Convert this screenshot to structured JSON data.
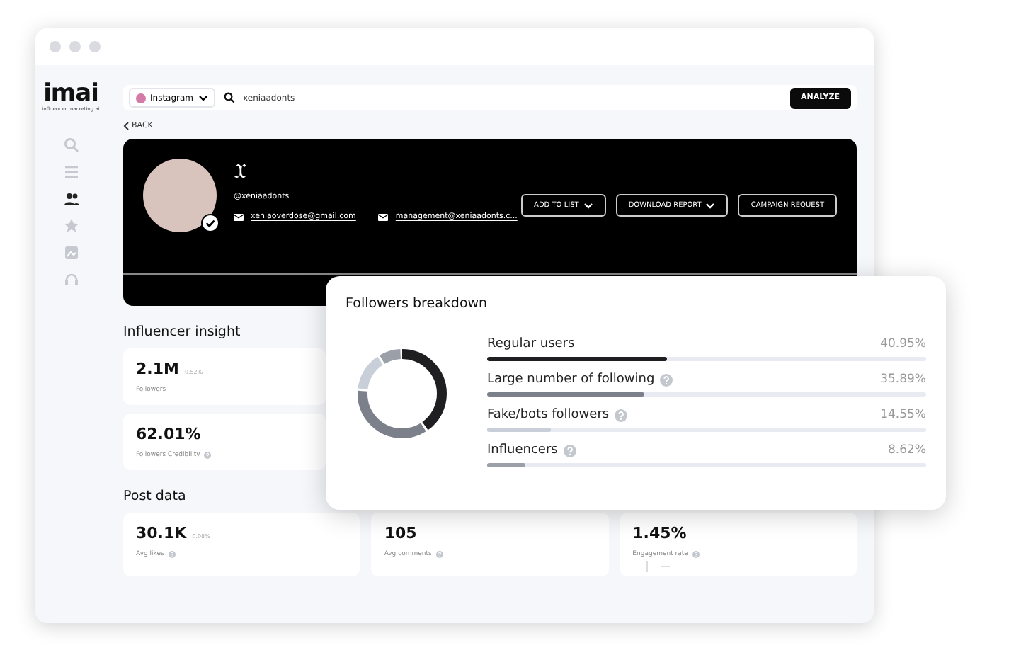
{
  "logo": {
    "name": "imai",
    "tagline": "influencer marketing ai"
  },
  "search": {
    "platform": "Instagram",
    "value": "xeniaadonts",
    "button": "ANALYZE"
  },
  "back": "BACK",
  "profile": {
    "name": "𝔛",
    "handle": "@xeniaadonts",
    "verified": true,
    "emails": [
      "xeniaoverdose@gmail.com",
      "management@xeniaadonts.c..."
    ],
    "buttons": [
      {
        "label": "ADD TO LIST",
        "dropdown": true
      },
      {
        "label": "DOWNLOAD REPORT",
        "dropdown": true
      },
      {
        "label": "CAMPAIGN REQUEST",
        "dropdown": false
      }
    ]
  },
  "influencer_insight": {
    "title": "Influencer insight",
    "cards": [
      {
        "value": "2.1M",
        "change": "0.52%",
        "label": "Followers",
        "info": false
      },
      {
        "value": "62.01%",
        "label": "Followers Credibility",
        "info": true
      }
    ]
  },
  "post_data": {
    "title": "Post data",
    "cards": [
      {
        "value": "30.1K",
        "change": "0.08%",
        "label": "Avg likes",
        "info": true
      },
      {
        "value": "105",
        "label": "Avg comments",
        "info": true
      },
      {
        "value": "1.45%",
        "label": "Engagement rate",
        "info": true
      }
    ]
  },
  "followers_breakdown": {
    "title": "Followers breakdown",
    "items": [
      {
        "label": "Regular users",
        "value": "40.95%",
        "level": 0.4095,
        "info": false,
        "color": "#1f1f22"
      },
      {
        "label": "Large number of following",
        "value": "35.89%",
        "level": 0.3589,
        "info": true,
        "color": "#7b808b"
      },
      {
        "label": "Fake/bots followers",
        "value": "14.55%",
        "level": 0.1455,
        "info": true,
        "color": "#c8cfd9"
      },
      {
        "label": "Influencers",
        "value": "8.62%",
        "level": 0.0862,
        "info": true,
        "color": "#9a9fa8"
      }
    ]
  }
}
